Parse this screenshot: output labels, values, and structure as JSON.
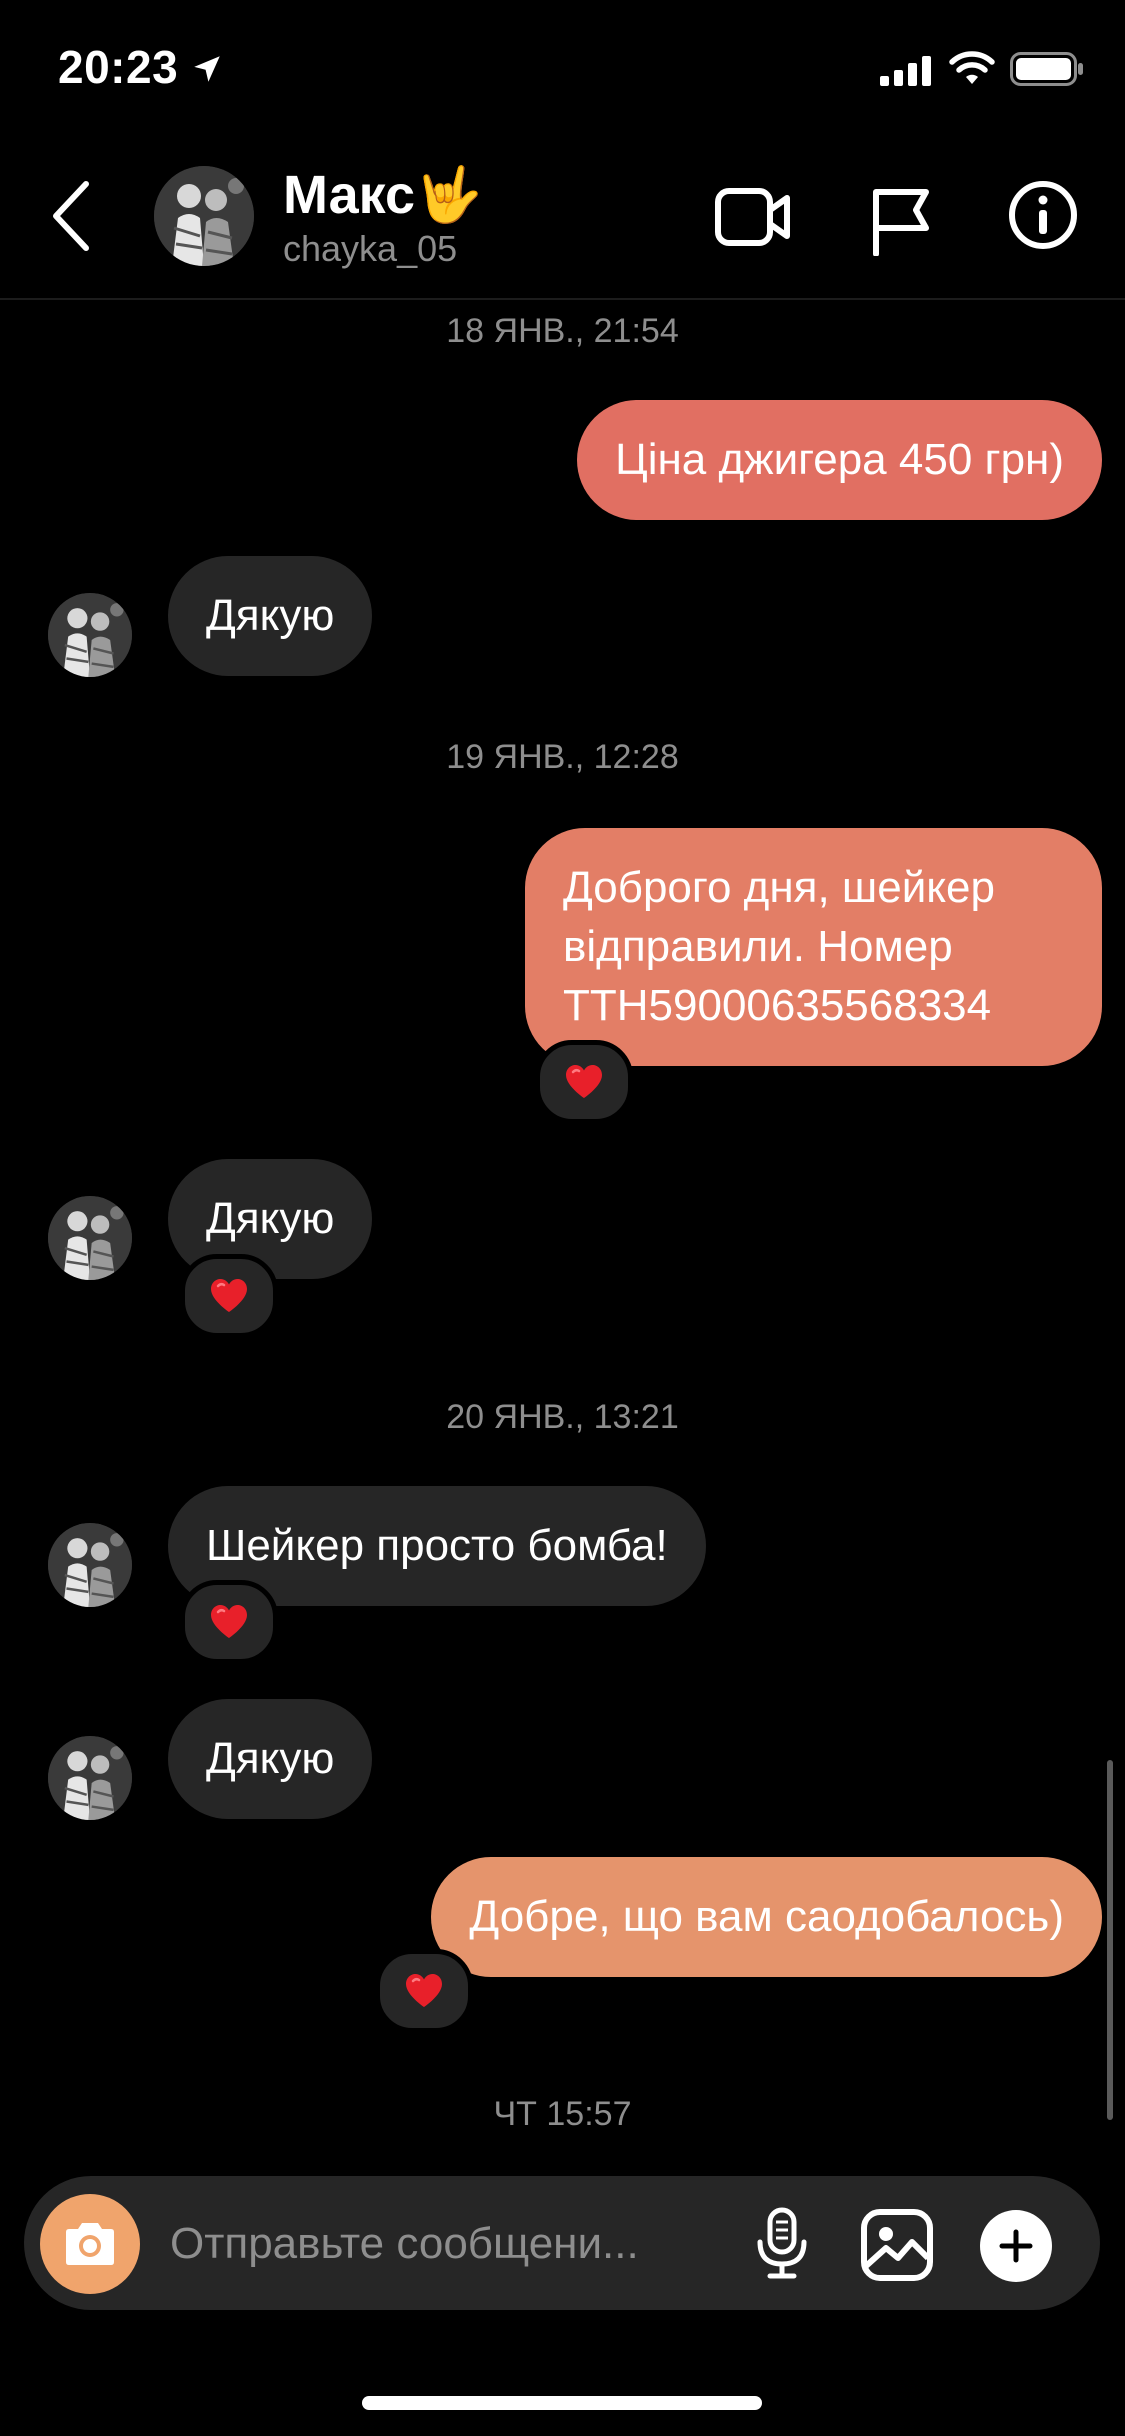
{
  "status_bar": {
    "time": "20:23"
  },
  "header": {
    "name": "Макс🤟",
    "username": "chayka_05"
  },
  "messages": [
    {
      "type": "timestamp",
      "text": "18 ЯНВ., 21:54"
    },
    {
      "type": "outgoing",
      "text": "Ціна джигера 450 грн)"
    },
    {
      "type": "incoming",
      "text": "Дякую"
    },
    {
      "type": "timestamp",
      "text": "19 ЯНВ., 12:28"
    },
    {
      "type": "outgoing",
      "text": "Доброго дня, шейкер відправили. Номер ТТН59000635568334",
      "reaction": "heart"
    },
    {
      "type": "incoming",
      "text": "Дякую",
      "reaction": "heart"
    },
    {
      "type": "timestamp",
      "text": "20 ЯНВ., 13:21"
    },
    {
      "type": "incoming",
      "text": "Шейкер просто бомба!",
      "reaction": "heart"
    },
    {
      "type": "incoming",
      "text": "Дякую"
    },
    {
      "type": "outgoing",
      "text": "Добре, що вам саодобалось)",
      "reaction": "heart"
    },
    {
      "type": "timestamp",
      "text": "ЧТ 15:57"
    }
  ],
  "composer": {
    "placeholder": "Отправьте сообщени..."
  },
  "colors": {
    "bubble_out_1": "#e16f62",
    "bubble_out_2": "#e37e66",
    "bubble_out_3": "#e5946c",
    "bubble_in": "#262626",
    "camera_button": "#f0a46c",
    "heart": "#e8202a"
  },
  "icons": [
    "location-arrow-icon",
    "signal-icon",
    "wifi-icon",
    "battery-icon",
    "back-chevron-icon",
    "video-call-icon",
    "flag-icon",
    "info-icon",
    "camera-icon",
    "microphone-icon",
    "gallery-icon",
    "plus-icon",
    "heart-icon"
  ]
}
